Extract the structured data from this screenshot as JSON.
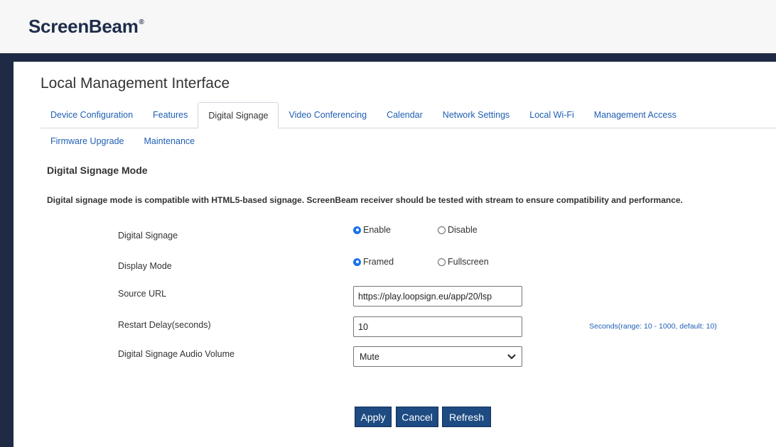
{
  "brand": {
    "logo_text": "ScreenBeam",
    "logo_mark": "®"
  },
  "page": {
    "title": "Local Management Interface"
  },
  "tabs_row1": [
    {
      "label": "Device Configuration",
      "active": false
    },
    {
      "label": "Features",
      "active": false
    },
    {
      "label": "Digital Signage",
      "active": true
    },
    {
      "label": "Video Conferencing",
      "active": false
    },
    {
      "label": "Calendar",
      "active": false
    },
    {
      "label": "Network Settings",
      "active": false
    },
    {
      "label": "Local Wi-Fi",
      "active": false
    },
    {
      "label": "Management Access",
      "active": false
    }
  ],
  "tabs_row2": [
    {
      "label": "Firmware Upgrade",
      "active": false
    },
    {
      "label": "Maintenance",
      "active": false
    }
  ],
  "section": {
    "title": "Digital Signage Mode",
    "description": "Digital signage mode is compatible with HTML5-based signage. ScreenBeam receiver should be tested with stream to ensure compatibility and performance."
  },
  "form": {
    "digital_signage": {
      "label": "Digital Signage",
      "options": [
        "Enable",
        "Disable"
      ],
      "selected": "Enable"
    },
    "display_mode": {
      "label": "Display Mode",
      "options": [
        "Framed",
        "Fullscreen"
      ],
      "selected": "Framed"
    },
    "source_url": {
      "label": "Source URL",
      "value": "https://play.loopsign.eu/app/20/lsp"
    },
    "restart_delay": {
      "label": "Restart Delay(seconds)",
      "value": "10",
      "hint": "Seconds(range: 10 - 1000, default: 10)"
    },
    "audio_volume": {
      "label": "Digital Signage Audio Volume",
      "value": "Mute"
    }
  },
  "buttons": {
    "apply": "Apply",
    "cancel": "Cancel",
    "refresh": "Refresh"
  },
  "colors": {
    "brand_dark": "#1f2b44",
    "link": "#1f5fb4",
    "button": "#1d4b82",
    "radio_selected": "#1a73e8"
  }
}
